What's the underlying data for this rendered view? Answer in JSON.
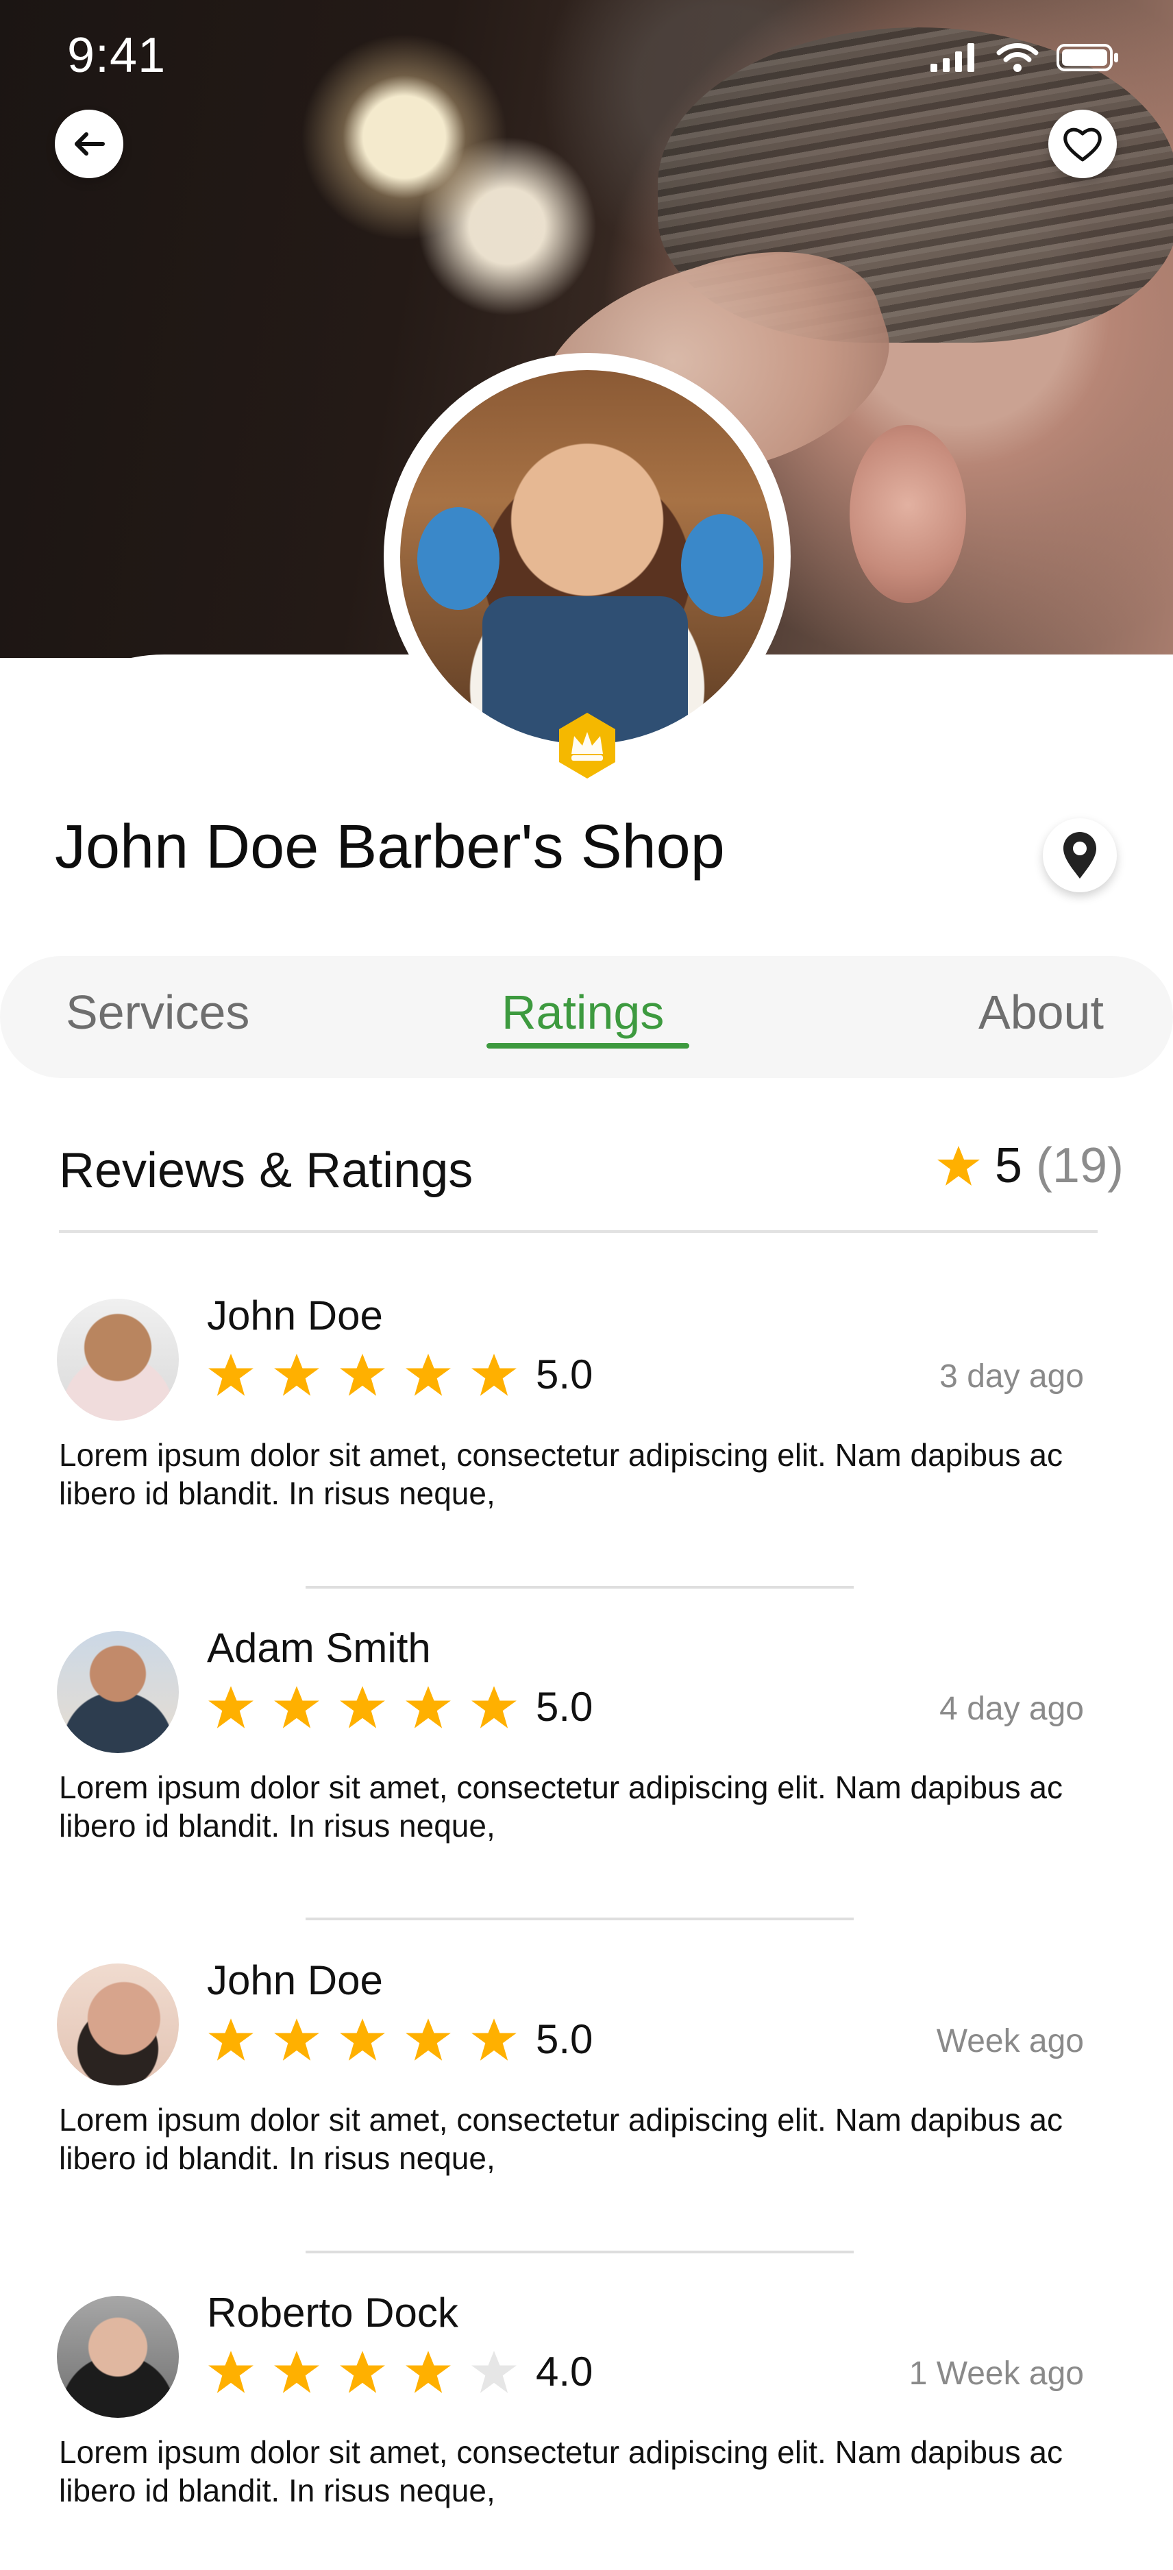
{
  "status_bar": {
    "time": "9:41"
  },
  "header": {
    "shop_name": "John Doe Barber's Shop"
  },
  "tabs": [
    {
      "label": "Services"
    },
    {
      "label": "Ratings"
    },
    {
      "label": "About"
    }
  ],
  "active_tab": "Ratings",
  "reviews_section": {
    "title": "Reviews & Ratings",
    "overall_score": "5",
    "review_count": "(19)"
  },
  "reviews": [
    {
      "name": "John Doe",
      "rating_value": 5,
      "rating_text": "5.0",
      "ago": "3 day ago",
      "text": "Lorem ipsum dolor sit amet, consectetur adipiscing elit. Nam dapibus ac libero id blandit. In risus neque,"
    },
    {
      "name": "Adam Smith",
      "rating_value": 5,
      "rating_text": "5.0",
      "ago": "4 day ago",
      "text": "Lorem ipsum dolor sit amet, consectetur adipiscing elit. Nam dapibus ac libero id blandit. In risus neque,"
    },
    {
      "name": "John Doe",
      "rating_value": 5,
      "rating_text": "5.0",
      "ago": "Week ago",
      "text": "Lorem ipsum dolor sit amet, consectetur adipiscing elit. Nam dapibus ac libero id blandit. In risus neque,"
    },
    {
      "name": "Roberto Dock",
      "rating_value": 4,
      "rating_text": "4.0",
      "ago": "1 Week ago",
      "text": "Lorem ipsum dolor sit amet, consectetur adipiscing elit. Nam dapibus ac libero id blandit. In risus neque,"
    }
  ],
  "colors": {
    "accent_green": "#3d9a3f",
    "star_gold": "#FFB000",
    "star_empty": "#e6e6e6",
    "badge_gold": "#F5B800"
  },
  "icons": {
    "back": "arrow-left-icon",
    "favorite": "heart-outline-icon",
    "location": "map-pin-icon",
    "premium": "crown-icon",
    "star": "star-icon"
  }
}
